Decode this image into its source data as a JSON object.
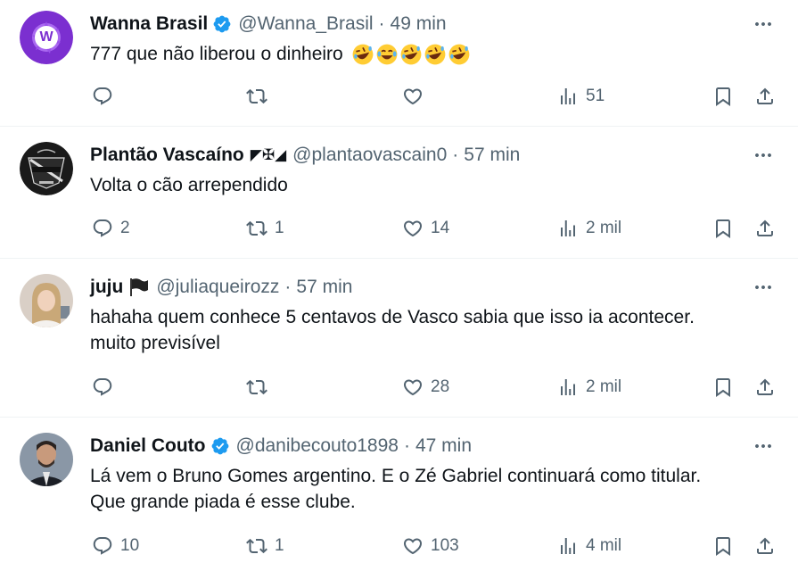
{
  "tweets": [
    {
      "name": "Wanna Brasil",
      "handle": "@Wanna_Brasil",
      "sep": "·",
      "time": "49 min",
      "text": "777 que não liberou o dinheiro",
      "emojis": [
        "rolling-on-floor-laughing",
        "tears-of-joy",
        "rolling-on-floor-laughing",
        "rolling-on-floor-laughing",
        "rolling-on-floor-laughing"
      ],
      "verified": true,
      "avatar_letter": "W",
      "reply_count": "",
      "retweet_count": "",
      "like_count": "",
      "view_count": "51"
    },
    {
      "name": "Plantão Vascaíno",
      "name_symbols": "◤✠◢",
      "handle": "@plantaovascain0",
      "sep": "·",
      "time": "57 min",
      "text": "Volta o cão arrependido",
      "reply_count": "2",
      "retweet_count": "1",
      "like_count": "14",
      "view_count": "2 mil"
    },
    {
      "name": "juju",
      "handle": "@juliaqueirozz",
      "sep": "·",
      "time": "57 min",
      "text_line1": "hahaha quem conhece 5 centavos de Vasco sabia que isso ia acontecer.",
      "text_line2": "muito previsível",
      "reply_count": "",
      "retweet_count": "",
      "like_count": "28",
      "view_count": "2 mil"
    },
    {
      "name": "Daniel Couto",
      "handle": "@danibecouto1898",
      "sep": "·",
      "time": "47 min",
      "text_line1": "Lá vem o Bruno Gomes argentino. E o Zé Gabriel continuará como titular.",
      "text_line2": "Que grande piada é esse clube.",
      "verified": true,
      "reply_count": "10",
      "retweet_count": "1",
      "like_count": "103",
      "view_count": "4 mil"
    }
  ],
  "colors": {
    "text": "#0f1419",
    "secondary": "#536471",
    "verified": "#1d9bf0",
    "divider": "#eff3f4",
    "wanna_purple": "#7b2fd0"
  }
}
